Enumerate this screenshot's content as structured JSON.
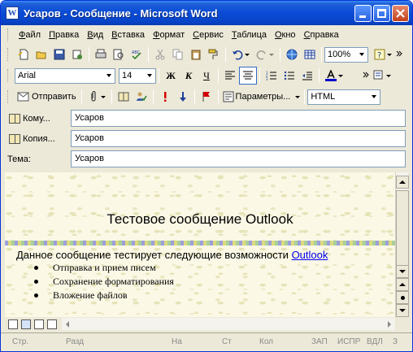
{
  "window": {
    "title": "Усаров - Сообщение - Microsoft Word",
    "app_icon_letter": "W"
  },
  "menu": [
    "Файл",
    "Правка",
    "Вид",
    "Вставка",
    "Формат",
    "Сервис",
    "Таблица",
    "Окно",
    "Справка"
  ],
  "standard_toolbar": {
    "zoom": "100%"
  },
  "format_toolbar": {
    "font": "Arial",
    "size": "14",
    "bold": "Ж",
    "italic": "К",
    "underline": "Ч"
  },
  "email_toolbar": {
    "send_label": "Отправить",
    "options_label": "Параметры...",
    "format_select": "HTML"
  },
  "header_fields": {
    "to_label": "Кому...",
    "to_value": "Усаров",
    "cc_label": "Копия...",
    "cc_value": "Усаров",
    "subject_label": "Тема:",
    "subject_value": "Усаров"
  },
  "document": {
    "heading": "Тестовое сообщение Outlook",
    "body_text": "Данное сообщение тестирует следующие возможности ",
    "link_text": "Outlook",
    "list": [
      "Отправка и прием писем",
      "Сохранение форматирования",
      "Вложение файлов"
    ]
  },
  "status_bar": {
    "page": "Стр.",
    "section": "Разд",
    "at": "На",
    "line": "Ст",
    "column": "Кол",
    "rec": "ЗАП",
    "trk": "ИСПР",
    "ext": "ВДЛ",
    "ovr": "З"
  },
  "colors": {
    "titlebar": "#0a4bd6",
    "close_button": "#c4401c",
    "chrome": "#ece9d8",
    "link": "#0000ee",
    "font_color": "#0000cc",
    "flag": "#d40000"
  }
}
